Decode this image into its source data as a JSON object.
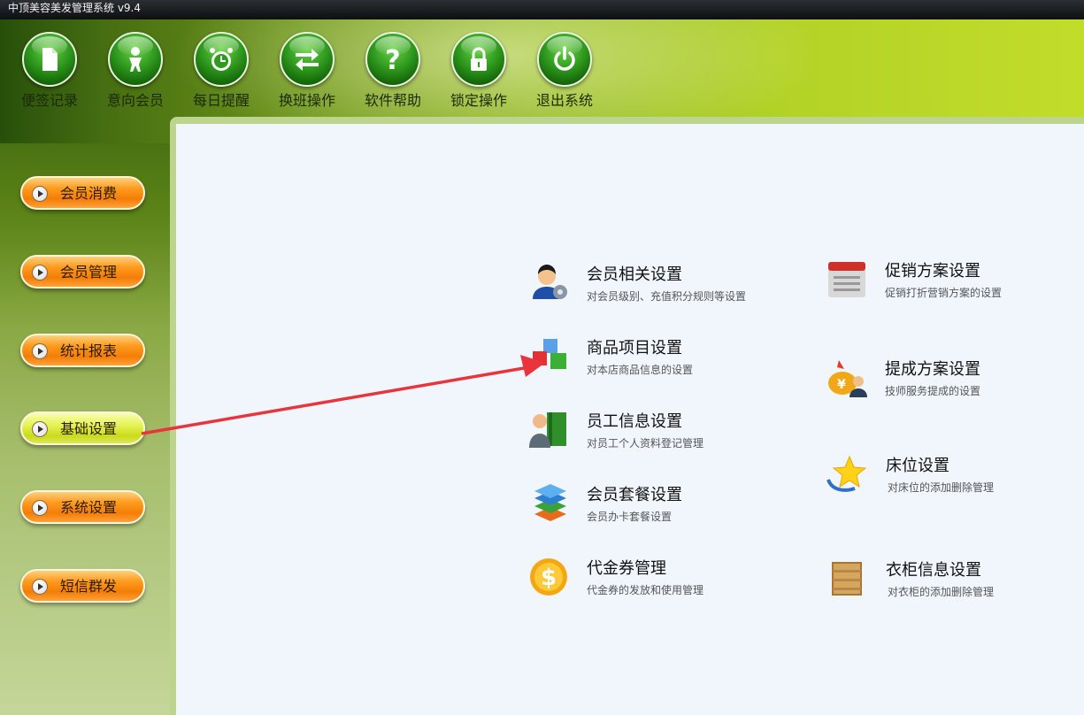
{
  "window": {
    "title": "中顶美容美发管理系统 v9.4"
  },
  "toolbar": [
    {
      "label": "便签记录",
      "icon": "document-icon"
    },
    {
      "label": "意向会员",
      "icon": "person-icon"
    },
    {
      "label": "每日提醒",
      "icon": "alarm-clock-icon"
    },
    {
      "label": "换班操作",
      "icon": "swap-arrows-icon"
    },
    {
      "label": "软件帮助",
      "icon": "question-icon"
    },
    {
      "label": "锁定操作",
      "icon": "lock-icon"
    },
    {
      "label": "退出系统",
      "icon": "power-icon"
    }
  ],
  "sidebar": [
    {
      "label": "会员消费"
    },
    {
      "label": "会员管理"
    },
    {
      "label": "统计报表"
    },
    {
      "label": "基础设置",
      "active": true
    },
    {
      "label": "系统设置"
    },
    {
      "label": "短信群发"
    }
  ],
  "settings": {
    "left": [
      {
        "title": "会员相关设置",
        "desc": "对会员级别、充值积分规则等设置",
        "icon": "member-settings-icon"
      },
      {
        "title": "商品项目设置",
        "desc": "对本店商品信息的设置",
        "icon": "product-cubes-icon"
      },
      {
        "title": "员工信息设置",
        "desc": "对员工个人资料登记管理",
        "icon": "employee-book-icon"
      },
      {
        "title": "会员套餐设置",
        "desc": "会员办卡套餐设置",
        "icon": "package-layers-icon"
      },
      {
        "title": "代金券管理",
        "desc": "代金券的发放和使用管理",
        "icon": "dollar-coin-icon"
      }
    ],
    "right": [
      {
        "title": "促销方案设置",
        "desc": "促销打折营销方案的设置",
        "icon": "calendar-icon"
      },
      {
        "title": "提成方案设置",
        "desc": "技师服务提成的设置",
        "icon": "commission-money-icon"
      },
      {
        "title": "床位设置",
        "desc": "对床位的添加删除管理",
        "icon": "star-icon"
      },
      {
        "title": "衣柜信息设置",
        "desc": "对衣柜的添加删除管理",
        "icon": "wardrobe-box-icon"
      }
    ]
  },
  "colors": {
    "annotation_arrow": "#e8343a"
  }
}
